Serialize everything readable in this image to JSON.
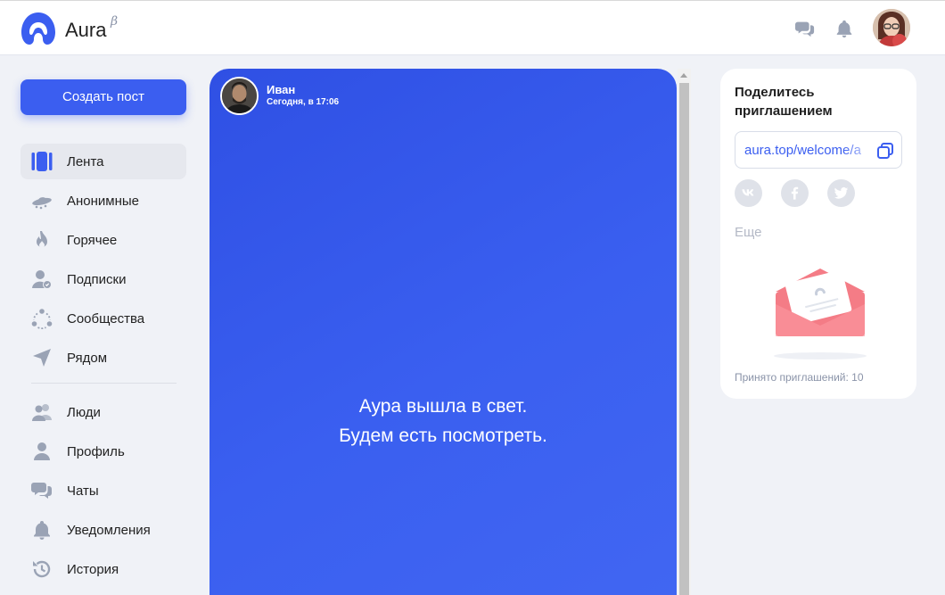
{
  "header": {
    "brand": "Aura",
    "brand_sup": "β",
    "icons": [
      "chats-icon",
      "bell-icon"
    ],
    "accent": "#3b5ef0"
  },
  "sidebar": {
    "create_button": "Создать пост",
    "items": [
      {
        "label": "Лента",
        "icon": "feed-icon",
        "active": true
      },
      {
        "label": "Анонимные",
        "icon": "ufo-icon"
      },
      {
        "label": "Горячее",
        "icon": "flame-icon"
      },
      {
        "label": "Подписки",
        "icon": "subscriptions-icon"
      },
      {
        "label": "Сообщества",
        "icon": "communities-icon"
      },
      {
        "label": "Рядом",
        "icon": "location-arrow-icon"
      },
      {
        "label": "Люди",
        "icon": "people-icon"
      },
      {
        "label": "Профиль",
        "icon": "profile-icon"
      },
      {
        "label": "Чаты",
        "icon": "chats-icon"
      },
      {
        "label": "Уведомления",
        "icon": "bell-icon"
      },
      {
        "label": "История",
        "icon": "history-icon"
      }
    ]
  },
  "post": {
    "author": "Иван",
    "time": "Сегодня, в 17:06",
    "text_line1": "Аура вышла в свет.",
    "text_line2": "Будем есть посмотреть.",
    "background": "#3a5ff0"
  },
  "invite": {
    "title": "Поделитесь приглашением",
    "link": "aura.top/welcome/a",
    "socials": [
      "vk-icon",
      "facebook-icon",
      "twitter-icon"
    ],
    "more": "Еще",
    "accepted": "Принято приглашений: 10"
  }
}
